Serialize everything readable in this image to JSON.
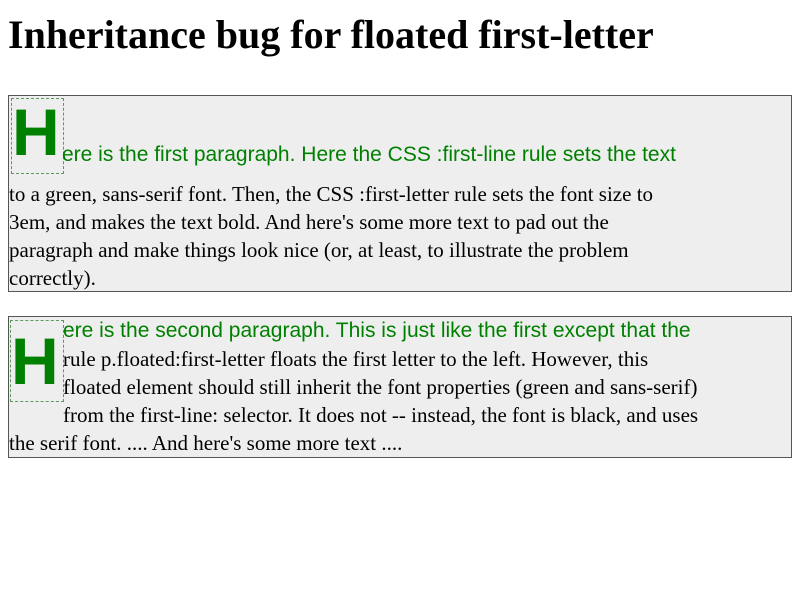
{
  "title": "Inheritance bug for floated first-letter",
  "para1": {
    "first_letter": "H",
    "line1": "ere is the first paragraph. Here the CSS :first-line rule sets the text",
    "line2": "to a green, sans-serif font. Then, the CSS :first-letter rule sets the font size to",
    "line3": "3em, and makes the text bold. And here's some more text to pad out the",
    "line4": "paragraph and make things look nice (or, at least, to illustrate the problem",
    "line5": "correctly)."
  },
  "para2": {
    "first_letter": "H",
    "line1": "ere is the second paragraph. This is just like the first except that the",
    "line2": "rule p.floated:first-letter floats the first letter to the left. However, this",
    "line3": "floated element should still inherit the font properties (green and sans-serif)",
    "line4": "from the first-line: selector. It does not -- instead, the font is black, and uses",
    "line5": "the serif font. .... And here's some more text ...."
  },
  "colors": {
    "accent_green": "#008000",
    "paragraph_bg": "#eeeeee"
  }
}
